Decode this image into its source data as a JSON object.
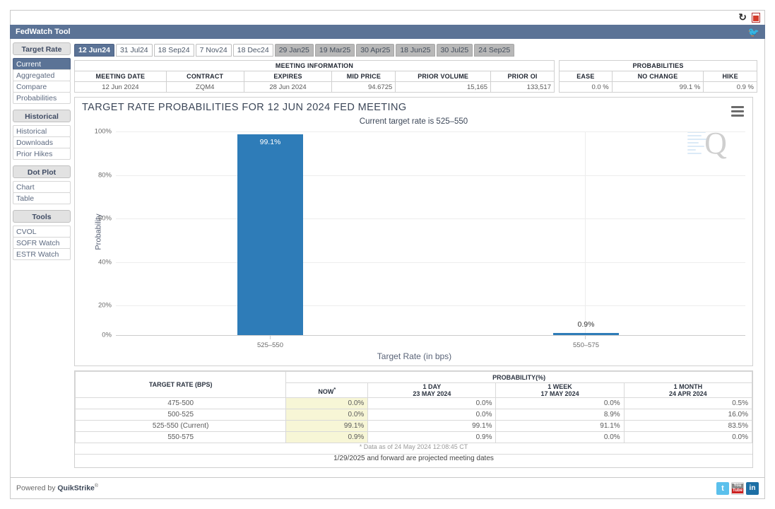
{
  "window": {
    "title": "FedWatch Tool",
    "refresh_icon": "refresh-icon",
    "pdf_icon": "pdf-icon",
    "twitter_icon": "twitter-icon"
  },
  "sidebar": {
    "groups": [
      {
        "label": "Target Rate",
        "items": [
          {
            "label": "Current",
            "active": true
          },
          {
            "label": "Aggregated",
            "active": false
          },
          {
            "label": "Compare",
            "active": false
          },
          {
            "label": "Probabilities",
            "active": false
          }
        ]
      },
      {
        "label": "Historical",
        "items": [
          {
            "label": "Historical",
            "active": false
          },
          {
            "label": "Downloads",
            "active": false
          },
          {
            "label": "Prior Hikes",
            "active": false
          }
        ]
      },
      {
        "label": "Dot Plot",
        "items": [
          {
            "label": "Chart",
            "active": false
          },
          {
            "label": "Table",
            "active": false
          }
        ]
      },
      {
        "label": "Tools",
        "items": [
          {
            "label": "CVOL",
            "active": false
          },
          {
            "label": "SOFR Watch",
            "active": false
          },
          {
            "label": "ESTR Watch",
            "active": false
          }
        ]
      }
    ]
  },
  "tabs": [
    {
      "label": "12 Jun24",
      "state": "active"
    },
    {
      "label": "31 Jul24",
      "state": "normal"
    },
    {
      "label": "18 Sep24",
      "state": "normal"
    },
    {
      "label": "7 Nov24",
      "state": "normal"
    },
    {
      "label": "18 Dec24",
      "state": "normal"
    },
    {
      "label": "29 Jan25",
      "state": "future"
    },
    {
      "label": "19 Mar25",
      "state": "future"
    },
    {
      "label": "30 Apr25",
      "state": "future"
    },
    {
      "label": "18 Jun25",
      "state": "future"
    },
    {
      "label": "30 Jul25",
      "state": "future"
    },
    {
      "label": "24 Sep25",
      "state": "future"
    }
  ],
  "meeting_information": {
    "group_header": "MEETING INFORMATION",
    "columns": [
      "MEETING DATE",
      "CONTRACT",
      "EXPIRES",
      "MID PRICE",
      "PRIOR VOLUME",
      "PRIOR OI"
    ],
    "row": [
      "12 Jun 2024",
      "ZQM4",
      "28 Jun 2024",
      "94.6725",
      "15,165",
      "133,517"
    ]
  },
  "probabilities_summary": {
    "group_header": "PROBABILITIES",
    "columns": [
      "EASE",
      "NO CHANGE",
      "HIKE"
    ],
    "row": [
      "0.0 %",
      "99.1 %",
      "0.9 %"
    ]
  },
  "chart_data": {
    "type": "bar",
    "title": "TARGET RATE PROBABILITIES FOR 12 JUN 2024 FED MEETING",
    "subtitle": "Current target rate is 525–550",
    "categories": [
      "525–550",
      "550–575"
    ],
    "values": [
      99.1,
      0.9
    ],
    "data_labels": [
      "99.1%",
      "0.9%"
    ],
    "xlabel": "Target Rate (in bps)",
    "ylabel": "Probability",
    "ylim": [
      0,
      100
    ],
    "yticks": [
      "0%",
      "20%",
      "40%",
      "60%",
      "80%",
      "100%"
    ],
    "ytick_values": [
      0,
      20,
      40,
      60,
      80,
      100
    ],
    "grid": true,
    "legend": "none",
    "bar_color": "#2e7cb8",
    "menu_icon": "hamburger-menu-icon",
    "watermark": "Q"
  },
  "probability_table": {
    "rate_header": "TARGET RATE (BPS)",
    "group_header": "PROBABILITY(%)",
    "columns": [
      {
        "line1": "NOW",
        "line2": "",
        "footmark": "*"
      },
      {
        "line1": "1 DAY",
        "line2": "23 MAY 2024",
        "footmark": ""
      },
      {
        "line1": "1 WEEK",
        "line2": "17 MAY 2024",
        "footmark": ""
      },
      {
        "line1": "1 MONTH",
        "line2": "24 APR 2024",
        "footmark": ""
      }
    ],
    "rows": [
      {
        "rate": "475-500",
        "now": "0.0%",
        "day": "0.0%",
        "week": "0.0%",
        "month": "0.5%"
      },
      {
        "rate": "500-525",
        "now": "0.0%",
        "day": "0.0%",
        "week": "8.9%",
        "month": "16.0%"
      },
      {
        "rate": "525-550 (Current)",
        "now": "99.1%",
        "day": "99.1%",
        "week": "91.1%",
        "month": "83.5%"
      },
      {
        "rate": "550-575",
        "now": "0.9%",
        "day": "0.9%",
        "week": "0.0%",
        "month": "0.0%"
      }
    ],
    "footnote": "* Data as of 24 May 2024 12:08:45 CT",
    "note": "1/29/2025 and forward are projected meeting dates"
  },
  "footer": {
    "powered_prefix": "Powered by ",
    "powered_brand": "QuikStrike",
    "powered_sup": "®",
    "social": [
      {
        "name": "twitter-icon",
        "glyph": "t"
      },
      {
        "name": "youtube-icon",
        "glyph": ""
      },
      {
        "name": "linkedin-icon",
        "glyph": "in"
      }
    ],
    "youtube_top": "You",
    "youtube_bottom": "Tube"
  }
}
